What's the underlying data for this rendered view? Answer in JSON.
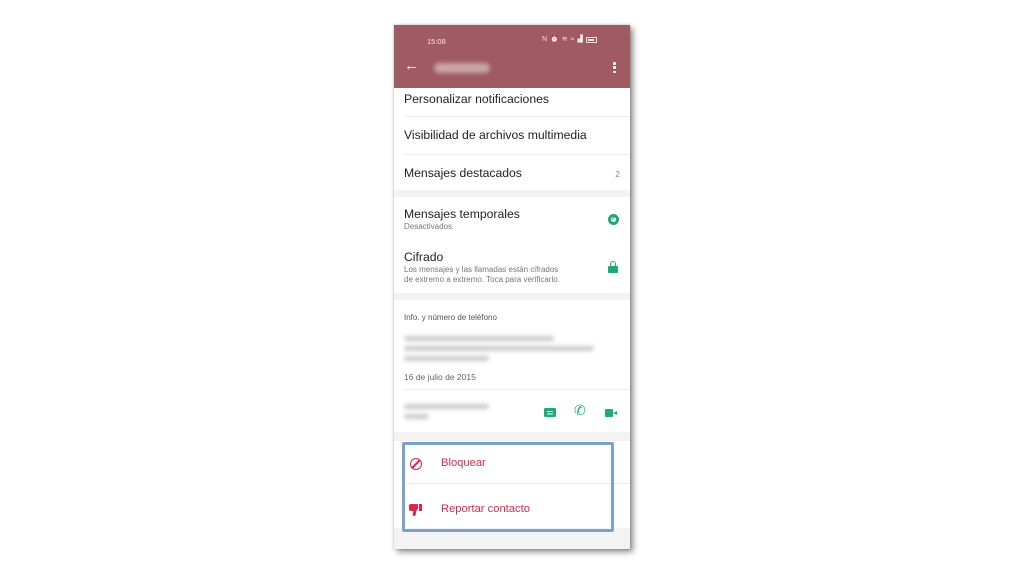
{
  "status_bar": {
    "time": "15:08",
    "icons": [
      "nfc-icon",
      "alarm-icon",
      "vibrate-icon",
      "wifi-icon",
      "signal-icon",
      "battery-icon"
    ]
  },
  "app_bar": {
    "back_icon": "arrow-left-icon",
    "menu_icon": "more-vertical-icon",
    "color": "#9f5a62"
  },
  "settings": {
    "custom_notifications": "Personalizar notificaciones",
    "media_visibility": "Visibilidad de archivos multimedia",
    "starred_messages": "Mensajes destacados",
    "starred_count": "2",
    "disappearing_title": "Mensajes temporales",
    "disappearing_sub": "Desactivados",
    "encryption_title": "Cifrado",
    "encryption_sub_1": "Los mensajes y las llamadas están cifrados",
    "encryption_sub_2": "de extremo a extremo. Toca para verificarlo."
  },
  "about": {
    "section_label": "Info. y número de teléfono",
    "date": "16 de julio de 2015"
  },
  "actions": {
    "block": "Bloquear",
    "report": "Reportar contacto"
  },
  "colors": {
    "accent_green": "#1faa75",
    "danger_red": "#d8284c",
    "highlight_border": "#7aa3cc"
  }
}
